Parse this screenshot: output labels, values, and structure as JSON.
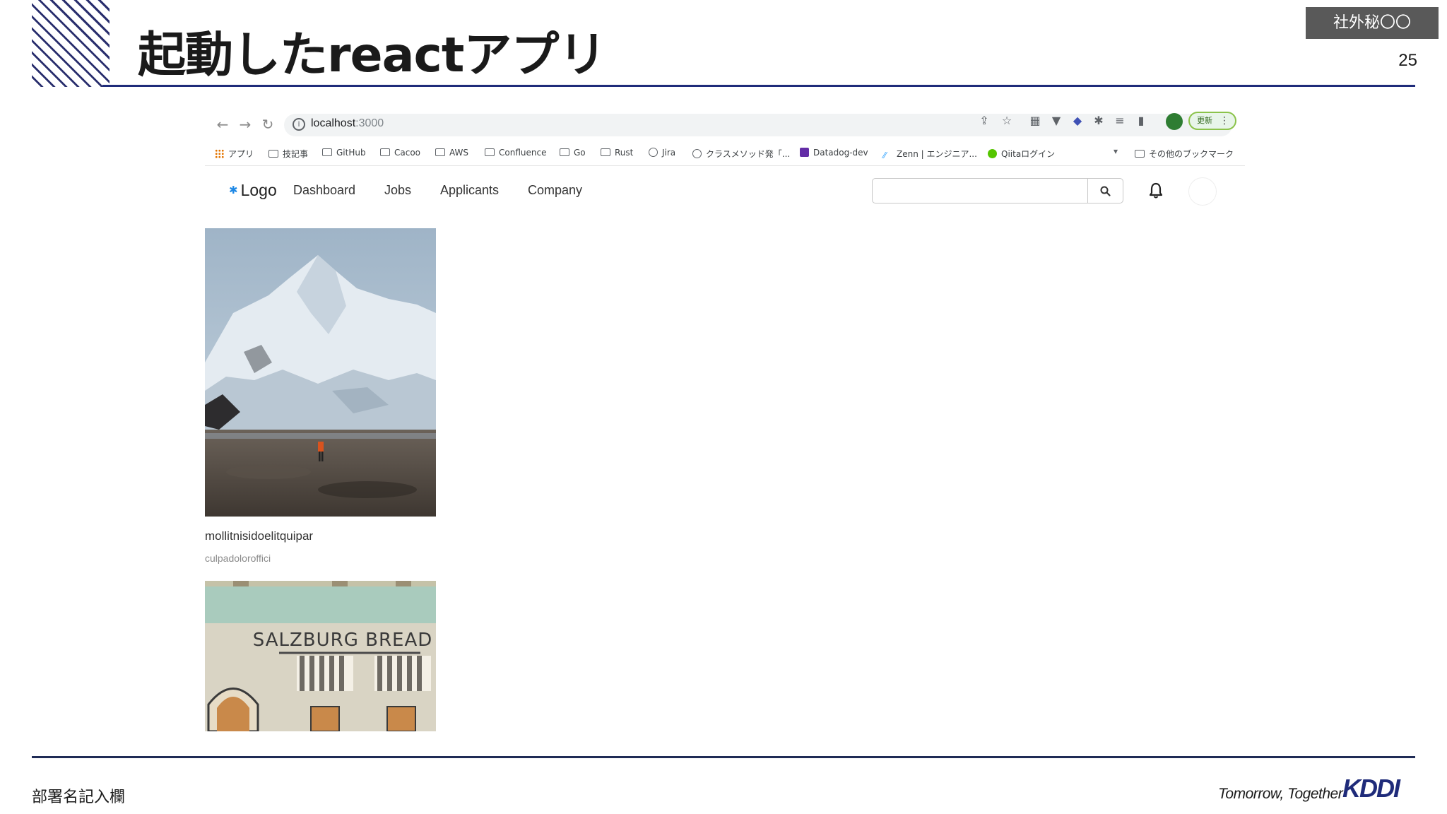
{
  "slide": {
    "title": "起動したreactアプリ",
    "confidential_label": "社外秘〇〇",
    "page_number": "25",
    "footer_department": "部署名記入欄",
    "footer_tagline": "Tomorrow, Together",
    "brand_logo_text": "KDDI",
    "accent_color": "#1f2b7a"
  },
  "browser": {
    "address_host": "localhost",
    "address_port": ":3000",
    "update_button_label": "更新",
    "bookmarks": [
      "アプリ",
      "技記事",
      "GitHub",
      "Cacoo",
      "AWS",
      "Confluence",
      "Go",
      "Rust",
      "Jira",
      "クラスメソッド発「...",
      "Datadog-dev",
      "Zenn | エンジニア...",
      "Qiitaログイン"
    ],
    "other_bookmarks": "その他のブックマーク"
  },
  "app": {
    "logo_text": "Logo",
    "nav_links": [
      "Dashboard",
      "Jobs",
      "Applicants",
      "Company"
    ],
    "search_placeholder": "",
    "cards": [
      {
        "title": "mollitnisidoelitquipar",
        "subtitle": "culpadoloroffici",
        "image": "mountain-photo"
      },
      {
        "image": "salzburg-bread-illustration",
        "sign_text": "SALZBURG BREAD"
      }
    ]
  }
}
